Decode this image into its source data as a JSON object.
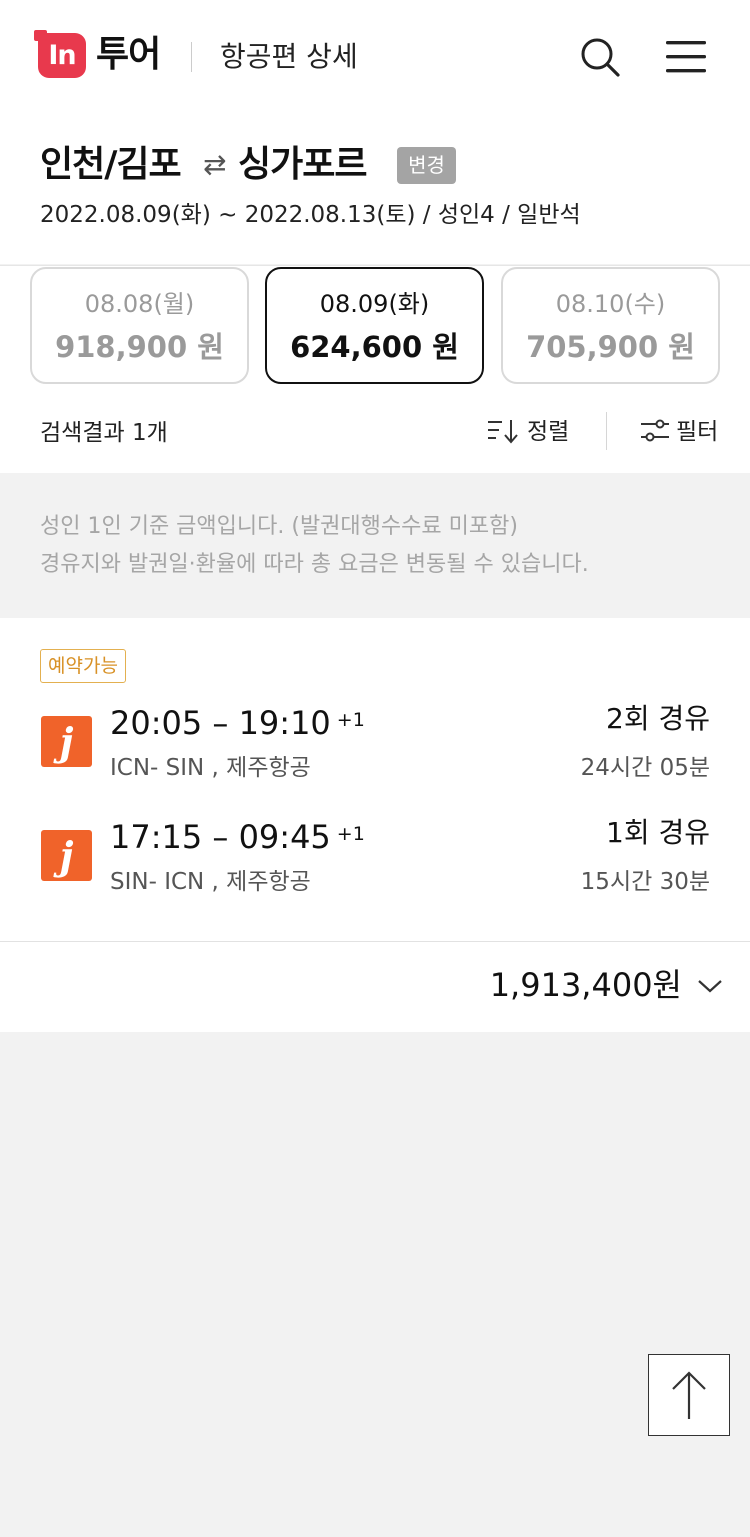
{
  "header": {
    "logo_mark": "In",
    "logo_text": "투어",
    "title": "항공편 상세",
    "search_icon": "search-icon",
    "menu_icon": "hamburger-menu-icon"
  },
  "route": {
    "origin": "인천/김포",
    "arrow": "⇄",
    "destination": "싱가포르",
    "change_label": "변경",
    "trip_info": "2022.08.09(화) ~ 2022.08.13(토) / 성인4 / 일반석"
  },
  "dates": [
    {
      "date": "08.08(월)",
      "price": "918,900 원",
      "selected": false
    },
    {
      "date": "08.09(화)",
      "price": "624,600 원",
      "selected": true
    },
    {
      "date": "08.10(수)",
      "price": "705,900 원",
      "selected": false
    }
  ],
  "toolbar": {
    "result_count": "검색결과 1개",
    "sort_label": "정렬",
    "filter_label": "필터"
  },
  "notice": {
    "line1": "성인 1인 기준 금액입니다. (발권대행수수료 미포함)",
    "line2": "경유지와 발권일·환율에 따라 총 요금은 변동될 수 있습니다."
  },
  "flight": {
    "badge": "예약가능",
    "airline_logo_letter": "j",
    "legs": [
      {
        "depart": "20:05",
        "dash": "–",
        "arrive": "19:10",
        "day_offset": "+1",
        "route": "ICN- SIN , 제주항공",
        "stops": "2회 경유",
        "duration": "24시간 05분"
      },
      {
        "depart": "17:15",
        "dash": "–",
        "arrive": "09:45",
        "day_offset": "+1",
        "route": "SIN- ICN , 제주항공",
        "stops": "1회 경유",
        "duration": "15시간 30분"
      }
    ],
    "total_price": "1,913,400원"
  },
  "colors": {
    "brand_red": "#e8394d",
    "airline_orange": "#f0632a",
    "badge_gold": "#d89126",
    "change_gray": "#a4a4a4"
  }
}
